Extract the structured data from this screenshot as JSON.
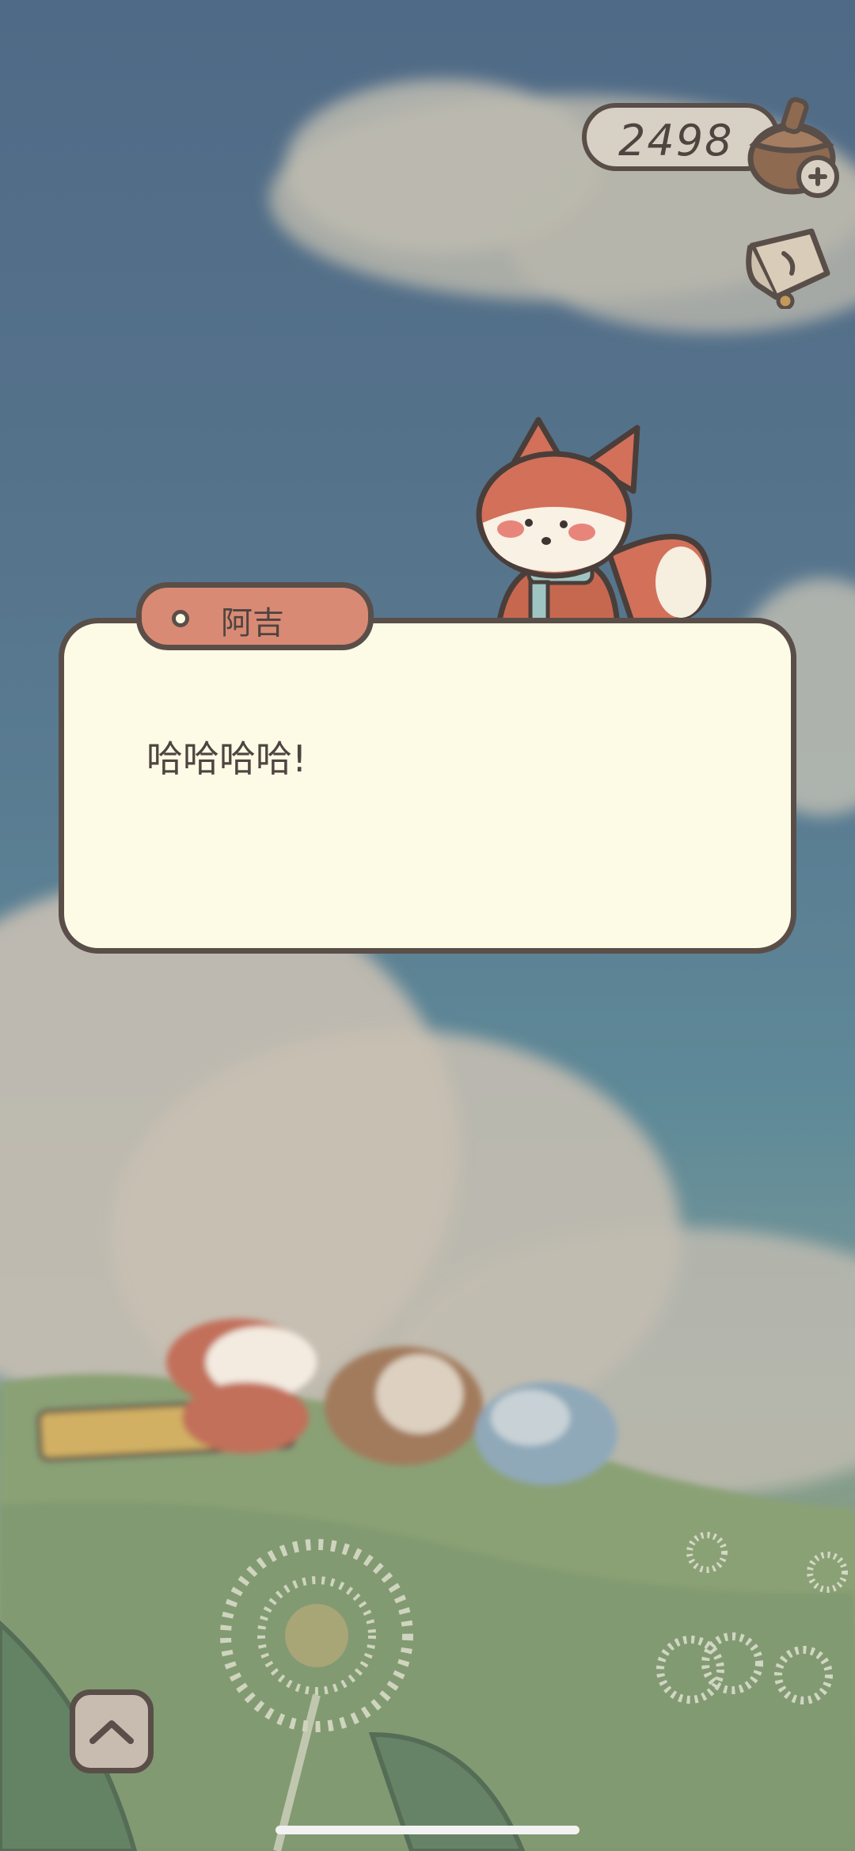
{
  "hud": {
    "acorn_count": "2498",
    "currency_icon": "acorn-icon",
    "add_icon": "plus-icon",
    "shop_icon": "shop-bag-icon"
  },
  "dialog": {
    "speaker": "阿吉",
    "text": "哈哈哈哈!"
  },
  "controls": {
    "expand_icon": "chevron-up-icon"
  },
  "colors": {
    "dialog_bg": "#fdfbe6",
    "tag_bg": "#d98a74",
    "outline": "#5a4e49"
  }
}
